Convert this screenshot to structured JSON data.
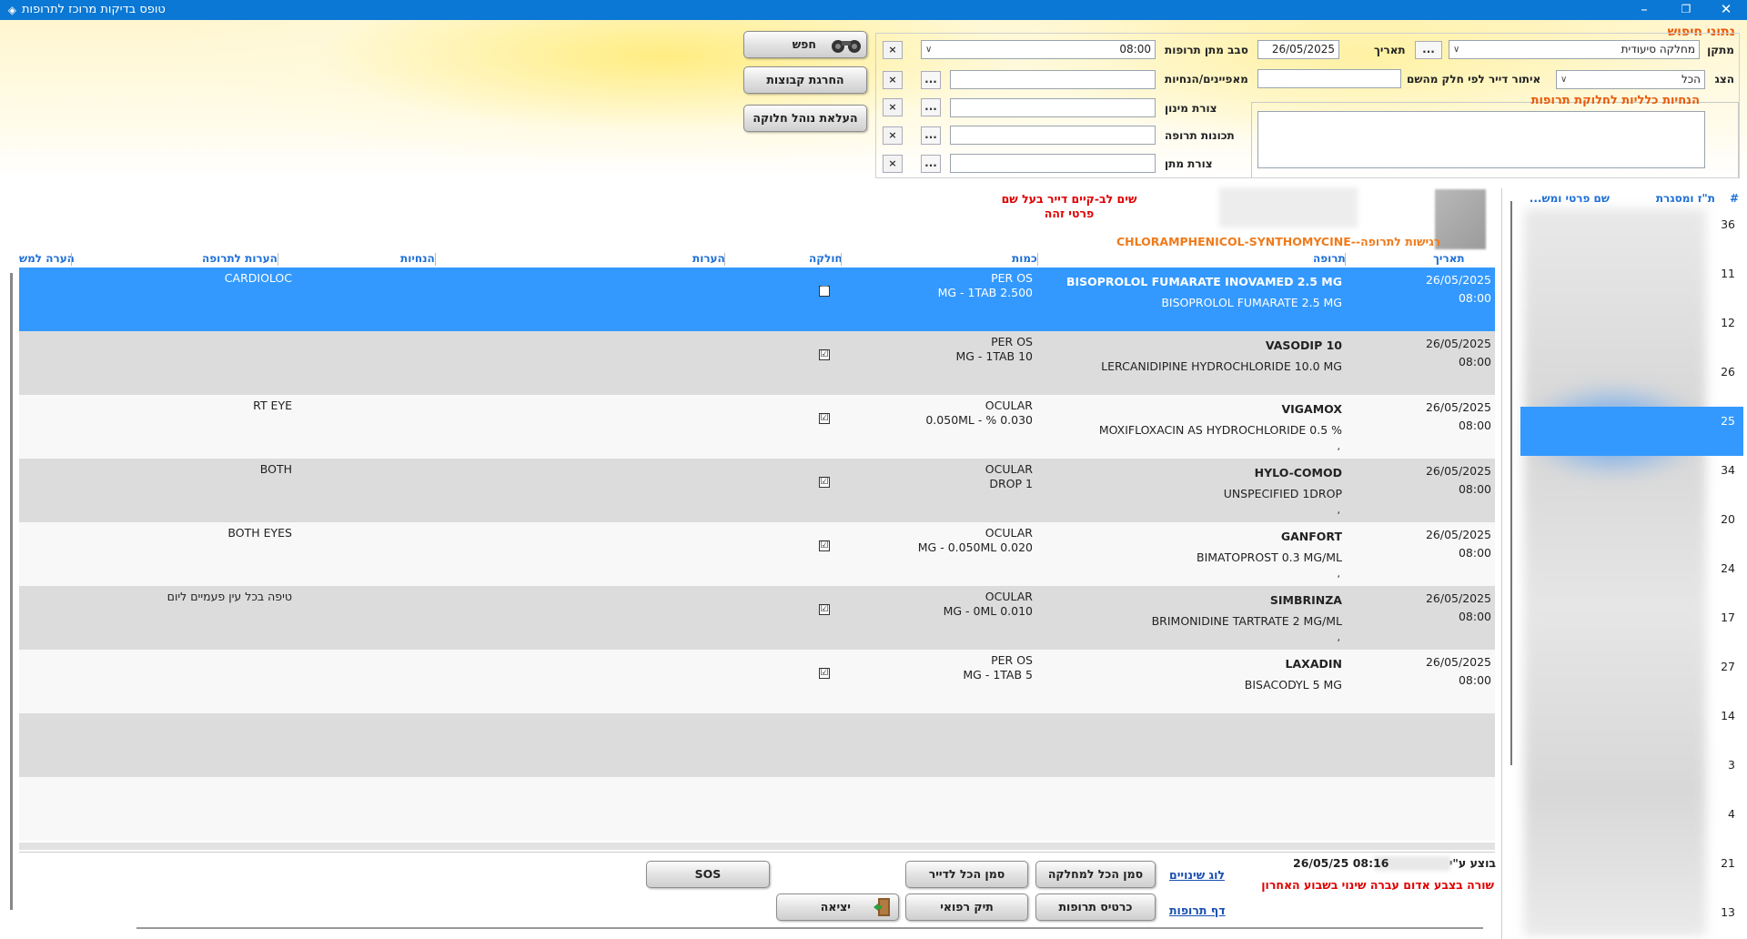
{
  "window": {
    "title": "טופס בדיקות מרוכז לתרופות",
    "minimize": "–",
    "restore": "❐",
    "close": "✕"
  },
  "search": {
    "section_title": "נתוני חיפוש",
    "facility_label": "מתקן",
    "facility_value": "מחלקה סיעודית",
    "facility_more": "...",
    "date_label": "תאריך",
    "date_value": "26/05/2025",
    "round_label": "סבב מתן תרופות",
    "round_value": "08:00",
    "show_label": "הצג",
    "show_value": "הכל",
    "resident_filter_label": "איתור דייר לפי חלק מהשם",
    "resident_filter_value": "",
    "characteristics_label": "מאפיינים/הנחיות",
    "dose_form_label": "צורת מינון",
    "properties_label": "תכונות תרופה",
    "give_form_label": "צורת מתן",
    "instructions_title": "הנחיות כלליות לחלוקת תרופות",
    "clear_symbol": "×",
    "more_symbol": "..."
  },
  "buttons": {
    "search": "חפש",
    "run_groups": "החרגת קבוצות",
    "upload_procedure": "העלאת נוהל חלוקה",
    "sos": "SOS",
    "mark_all_resident": "סמן הכל לדייר",
    "mark_all_department": "סמן הכל למחלקה",
    "medical_file": "תיק רפואי",
    "drug_card": "כרטיס תרופות",
    "exit": "יציאה"
  },
  "resident": {
    "warning_line1": "שים לב-קיים דייר בעל שם",
    "warning_line2": "פרטי זהה",
    "allergy": "רגישות לתרופה--CHLORAMPHENICOL-SYNTHOMYCINE"
  },
  "table": {
    "headers": {
      "date": "תאריך",
      "drug": "תרופה",
      "quantity": "כמות",
      "distributed": "חולקה",
      "remarks": "הערות",
      "instructions": "הנחיות",
      "drug_notes": "הערות לתרופה",
      "note_short": "הערה למש"
    },
    "rows": [
      {
        "date": "26/05/2025",
        "time": "08:00",
        "name": "BISOPROLOL FUMARATE INOVAMED 2.5 MG",
        "generic": "BISOPROLOL FUMARATE 2.5 MG",
        "route": "PER OS",
        "qty": "MG - 1TAB 2.500",
        "note": "CARDIOLOC",
        "comma": "",
        "checked": "☑"
      },
      {
        "date": "26/05/2025",
        "time": "08:00",
        "name": "VASODIP 10",
        "generic": "LERCANIDIPINE HYDROCHLORIDE 10.0 MG",
        "route": "PER OS",
        "qty": "MG - 1TAB 10",
        "note": "",
        "comma": "",
        "checked": "☑"
      },
      {
        "date": "26/05/2025",
        "time": "08:00",
        "name": "VIGAMOX",
        "generic": "MOXIFLOXACIN AS HYDROCHLORIDE 0.5 %",
        "route": "OCULAR",
        "qty": "0.050ML - % 0.030",
        "note": "RT EYE",
        "comma": ",",
        "checked": "☑"
      },
      {
        "date": "26/05/2025",
        "time": "08:00",
        "name": "HYLO-COMOD",
        "generic": "UNSPECIFIED 1DROP",
        "route": "OCULAR",
        "qty": "DROP 1",
        "note": "BOTH",
        "comma": ",",
        "checked": "☑"
      },
      {
        "date": "26/05/2025",
        "time": "08:00",
        "name": "GANFORT",
        "generic": "BIMATOPROST 0.3 MG/ML",
        "route": "OCULAR",
        "qty": "MG - 0.050ML 0.020",
        "note": "BOTH EYES",
        "comma": ",",
        "checked": "☑"
      },
      {
        "date": "26/05/2025",
        "time": "08:00",
        "name": "SIMBRINZA",
        "generic": "BRIMONIDINE TARTRATE 2 MG/ML",
        "route": "OCULAR",
        "qty": "MG - 0ML 0.010",
        "note": "טיפה בכל עין פעמיים ליום",
        "comma": ",",
        "checked": "☑"
      },
      {
        "date": "26/05/2025",
        "time": "08:00",
        "name": "LAXADIN",
        "generic": "BISACODYL 5 MG",
        "route": "PER OS",
        "qty": "MG - 1TAB 5",
        "note": "",
        "comma": "",
        "checked": "☑"
      }
    ]
  },
  "footer": {
    "change_log": "לוג שינויים",
    "drug_page": "דף תרופות",
    "done_by_label": "בוצע ע\"י",
    "done_time": "08:16 26/05/25",
    "legend": "שורה בצבע אדום עברה שינוי בשבוע האחרון"
  },
  "residents": {
    "headers": {
      "num": "#",
      "id": "ת\"ז ומסגרת",
      "name": "שם פרטי ומש..."
    },
    "numbers": [
      "36",
      "11",
      "12",
      "26",
      "25",
      "34",
      "20",
      "24",
      "17",
      "27",
      "14",
      "3",
      "4",
      "21",
      "13"
    ]
  },
  "icons": {
    "binoculars": "binoculars-icon",
    "exit": "exit-door-icon",
    "app": "app-icon"
  }
}
